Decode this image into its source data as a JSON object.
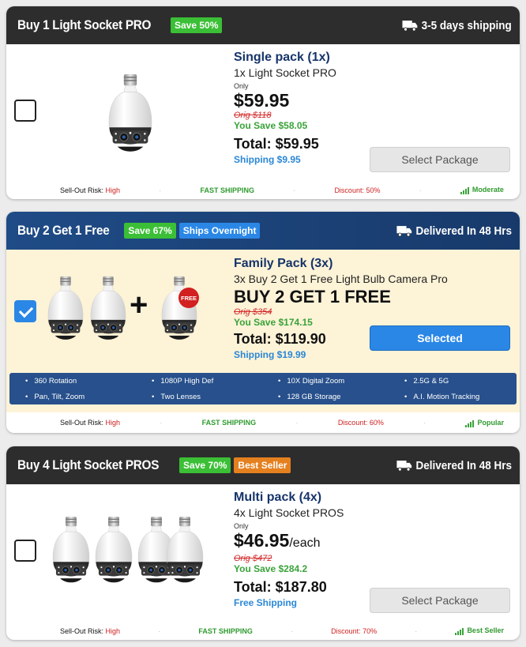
{
  "packages": [
    {
      "header": {
        "title": "Buy 1 Light Socket PRO",
        "badges": [
          "Save 50%"
        ],
        "shipping": "3-5 days shipping"
      },
      "checked": false,
      "name": "Single pack (1x)",
      "subtitle": "1x Light Socket PRO",
      "only": "Only",
      "price": "$59.95",
      "orig": "Orig $118",
      "you_save": "You Save $58.05",
      "total": "Total: $59.95",
      "shipping": "Shipping $9.95",
      "button": "Select Package",
      "footer": {
        "risk_label": "Sell-Out Risk:",
        "risk": "High",
        "fast": "FAST SHIPPING",
        "discount": "Discount: 50%",
        "demand": "Moderate"
      }
    },
    {
      "header": {
        "title": "Buy 2 Get 1 Free",
        "badges": [
          "Save 67%",
          "Ships Overnight"
        ],
        "shipping": "Delivered In 48 Hrs"
      },
      "checked": true,
      "name": "Family Pack (3x)",
      "subtitle": "3x Buy 2 Get 1 Free Light Bulb Camera Pro",
      "headline": "BUY 2 GET 1 FREE",
      "orig": "Orig $354",
      "you_save": "You Save $174.15",
      "total": "Total: $119.90",
      "shipping": "Shipping $19.99",
      "button": "Selected",
      "free_tag": "FREE",
      "features": [
        "360 Rotation",
        "1080P High Def",
        "10X Digital Zoom",
        "2.5G & 5G",
        "Pan, Tilt, Zoom",
        "Two Lenses",
        "128 GB Storage",
        "A.I. Motion Tracking"
      ],
      "footer": {
        "risk_label": "Sell-Out Risk:",
        "risk": "High",
        "fast": "FAST SHIPPING",
        "discount": "Discount: 60%",
        "demand": "Popular"
      }
    },
    {
      "header": {
        "title": "Buy 4 Light Socket PROS",
        "badges": [
          "Save 70%",
          "Best Seller"
        ],
        "shipping": "Delivered In 48 Hrs"
      },
      "checked": false,
      "name": "Multi pack (4x)",
      "subtitle": "4x Light Socket PROS",
      "only": "Only",
      "price": "$46.95",
      "each": "/each",
      "orig": "Orig $472",
      "you_save": "You Save $284.2",
      "total": "Total: $187.80",
      "shipping": "Free Shipping",
      "button": "Select Package",
      "footer": {
        "risk_label": "Sell-Out Risk:",
        "risk": "High",
        "fast": "FAST SHIPPING",
        "discount": "Discount: 70%",
        "demand": "Best Seller"
      }
    }
  ],
  "colors": {
    "accent_blue": "#2a87e6",
    "save_green": "#3bbf36",
    "best_orange": "#e5801f",
    "header_dark": "#2d2d2d",
    "header_navy": "#1f4b86"
  },
  "icons": {
    "shipping": "truck-icon",
    "demand": "signal-bars-icon",
    "product": "bulb-camera"
  }
}
